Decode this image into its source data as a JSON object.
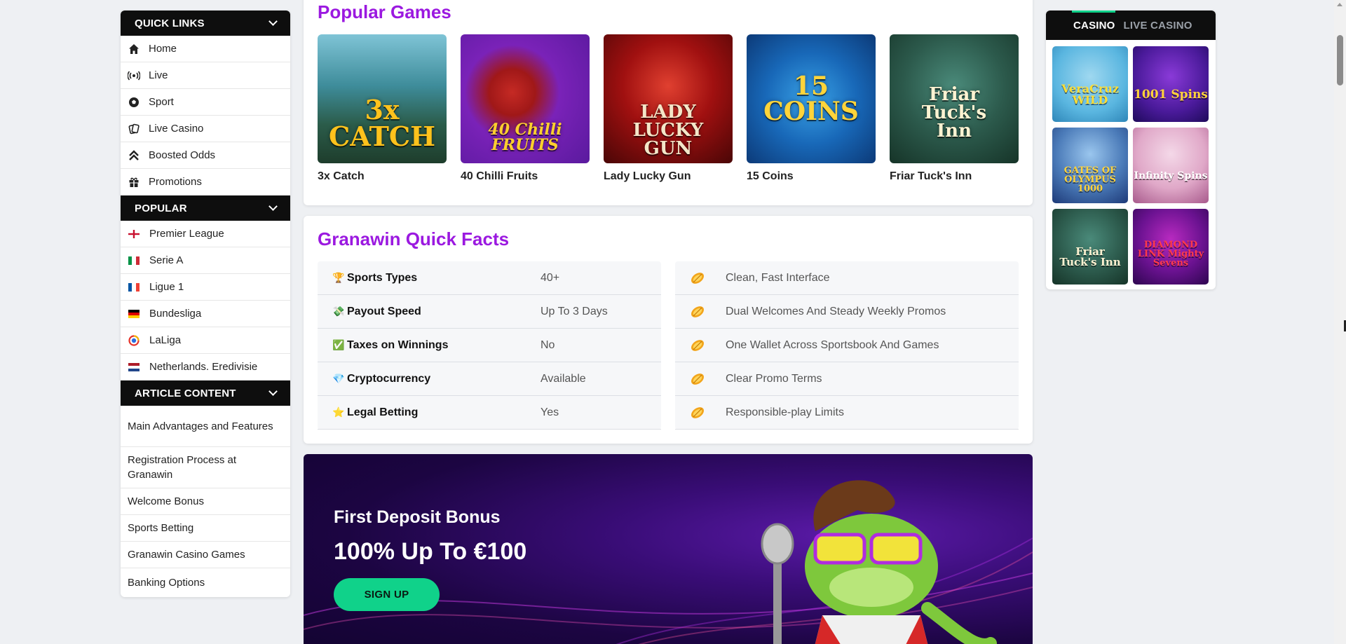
{
  "sidebar": {
    "quick_links_header": "QUICK LINKS",
    "quick_links": [
      {
        "label": "Home",
        "icon": "home-icon"
      },
      {
        "label": "Live",
        "icon": "broadcast-icon"
      },
      {
        "label": "Sport",
        "icon": "soccer-ball-icon"
      },
      {
        "label": "Live Casino",
        "icon": "cards-icon"
      },
      {
        "label": "Boosted Odds",
        "icon": "double-chevron-up-icon"
      },
      {
        "label": "Promotions",
        "icon": "gift-icon"
      }
    ],
    "popular_header": "POPULAR",
    "popular": [
      {
        "label": "Premier League",
        "flag": "england-flag-icon"
      },
      {
        "label": "Serie A",
        "flag": "italy-flag-icon"
      },
      {
        "label": "Ligue 1",
        "flag": "france-flag-icon"
      },
      {
        "label": "Bundesliga",
        "flag": "germany-flag-icon"
      },
      {
        "label": "LaLiga",
        "flag": "laliga-logo-icon"
      },
      {
        "label": "Netherlands. Eredivisie",
        "flag": "netherlands-flag-icon"
      }
    ],
    "article_header": "ARTICLE CONTENT",
    "article": [
      "Main Advantages and Features",
      "Registration Process at Granawin",
      "Welcome Bonus",
      "Sports Betting",
      "Granawin Casino Games",
      "Banking Options"
    ]
  },
  "popular_games": {
    "title": "Popular Games",
    "games": [
      {
        "name": "3x Catch",
        "logo": "3x CATCH"
      },
      {
        "name": "40 Chilli Fruits",
        "logo": "40 Chilli FRUITS"
      },
      {
        "name": "Lady Lucky Gun",
        "logo": "LADY LUCKY GUN"
      },
      {
        "name": "15 Coins",
        "logo": "15 COINS"
      },
      {
        "name": "Friar Tuck's Inn",
        "logo": "Friar Tuck's Inn"
      }
    ]
  },
  "quick_facts": {
    "title": "Granawin Quick Facts",
    "left": [
      {
        "emoji": "🏆",
        "label": "Sports Types",
        "value": "40+"
      },
      {
        "emoji": "💸",
        "label": "Payout Speed",
        "value": "Up To 3 Days"
      },
      {
        "emoji": "✅",
        "label": "Taxes on Winnings",
        "value": "No"
      },
      {
        "emoji": "💎",
        "label": "Cryptocurrency",
        "value": "Available"
      },
      {
        "emoji": "⭐",
        "label": "Legal Betting",
        "value": "Yes"
      }
    ],
    "right": [
      "Clean, Fast Interface",
      "Dual Welcomes And Steady Weekly Promos",
      "One Wallet Across Sportsbook And Games",
      "Clear Promo Terms",
      "Responsible-play Limits"
    ]
  },
  "banner": {
    "subtitle": "First Deposit Bonus",
    "headline": "100% Up To €100",
    "button": "SIGN UP"
  },
  "right_widget": {
    "tab_active": "CASINO",
    "tab_inactive": "LIVE CASINO",
    "games": [
      {
        "logo": "VeraCruz WILD"
      },
      {
        "logo": "1001 Spins"
      },
      {
        "logo": "GATES OF OLYMPUS 1000"
      },
      {
        "logo": "Infinity Spins"
      },
      {
        "logo": "Friar Tuck's Inn"
      },
      {
        "logo": "DIAMOND LINK Mighty Sevens"
      }
    ]
  },
  "colors": {
    "accent_purple": "#9b19e0",
    "accent_green": "#10d28a",
    "header_black": "#0e0e0e"
  }
}
